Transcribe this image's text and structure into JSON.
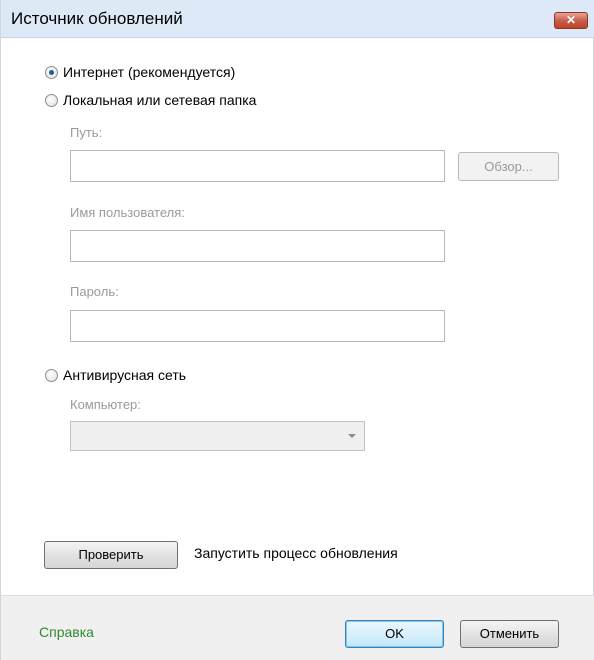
{
  "window": {
    "title": "Источник обновлений",
    "close_glyph": "✕"
  },
  "source": {
    "internet_label": "Интернет (рекомендуется)",
    "internet_selected": true,
    "folder_label": "Локальная или сетевая папка",
    "folder_selected": false,
    "path_label": "Путь:",
    "path_value": "",
    "browse_label": "Обзор...",
    "username_label": "Имя пользователя:",
    "username_value": "",
    "password_label": "Пароль:",
    "password_value": "",
    "av_network_label": "Антивирусная сеть",
    "av_network_selected": false,
    "computer_label": "Компьютер:",
    "computer_value": ""
  },
  "check": {
    "button_label": "Проверить",
    "description": "Запустить процесс обновления"
  },
  "footer": {
    "help_label": "Справка",
    "ok_label": "OK",
    "cancel_label": "Отменить"
  },
  "colors": {
    "help_link": "#2f8a2f",
    "disabled_text": "#9a9a9a",
    "titlebar": "#dde9f6",
    "close_button": "#c75a47"
  }
}
